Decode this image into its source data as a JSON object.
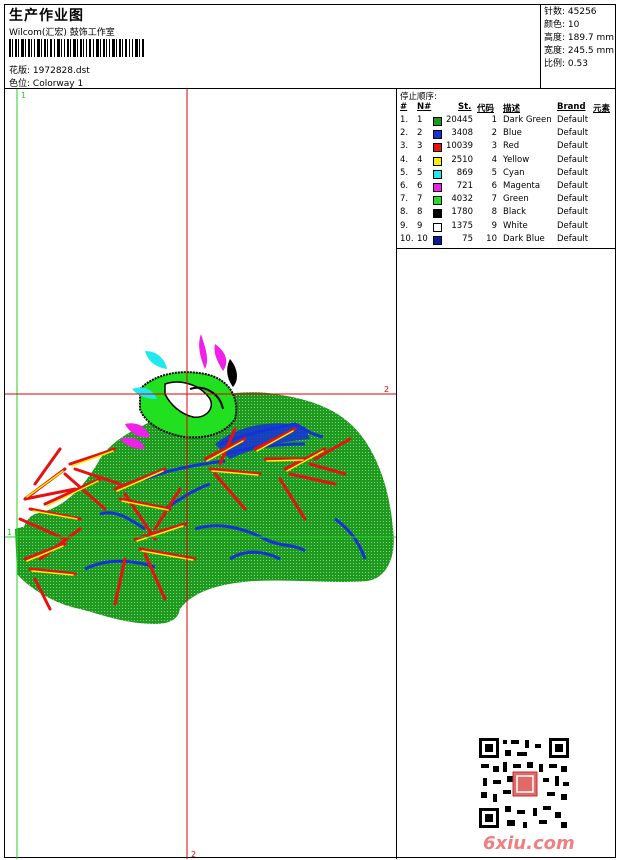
{
  "header": {
    "title": "生产作业图",
    "company": "Wilcom(汇宏) 鼓饰工作室",
    "design_label": "花版:",
    "design_value": "1972828.dst",
    "color_label": "色位:",
    "color_value": "Colorway 1"
  },
  "stats": {
    "stitches": "针数: 45256",
    "colors": "颜色: 10",
    "height": "高度: 189.7 mm",
    "width": "宽度: 245.5 mm",
    "scale": "比例: 0.53"
  },
  "canvas": {
    "marker_top": "1",
    "marker_left": "1",
    "marker_right": "2",
    "marker_bottom": "2"
  },
  "stop_sequence": {
    "title": "停止顺序:",
    "headers": {
      "num": "#",
      "n": "N#",
      "st": "St.",
      "code": "代码",
      "desc": "描述",
      "brand": "Brand",
      "element": "元素"
    },
    "rows": [
      {
        "num": "1.",
        "n": "1",
        "color": "#1e9a1e",
        "st": "20445",
        "code": "1",
        "desc": "Dark Green",
        "brand": "Default"
      },
      {
        "num": "2.",
        "n": "2",
        "color": "#1432d8",
        "st": "3408",
        "code": "2",
        "desc": "Blue",
        "brand": "Default"
      },
      {
        "num": "3.",
        "n": "3",
        "color": "#e81010",
        "st": "10039",
        "code": "3",
        "desc": "Red",
        "brand": "Default"
      },
      {
        "num": "4.",
        "n": "4",
        "color": "#f8f000",
        "st": "2510",
        "code": "4",
        "desc": "Yellow",
        "brand": "Default"
      },
      {
        "num": "5.",
        "n": "5",
        "color": "#20e8f0",
        "st": "869",
        "code": "5",
        "desc": "Cyan",
        "brand": "Default"
      },
      {
        "num": "6.",
        "n": "6",
        "color": "#f020e8",
        "st": "721",
        "code": "6",
        "desc": "Magenta",
        "brand": "Default"
      },
      {
        "num": "7.",
        "n": "7",
        "color": "#20e020",
        "st": "4032",
        "code": "7",
        "desc": "Green",
        "brand": "Default"
      },
      {
        "num": "8.",
        "n": "8",
        "color": "#000000",
        "st": "1780",
        "code": "8",
        "desc": "Black",
        "brand": "Default"
      },
      {
        "num": "9.",
        "n": "9",
        "color": "#ffffff",
        "st": "1375",
        "code": "9",
        "desc": "White",
        "brand": "Default"
      },
      {
        "num": "10.",
        "n": "10",
        "color": "#0a1a9a",
        "st": "75",
        "code": "10",
        "desc": "Dark Blue",
        "brand": "Default"
      }
    ]
  },
  "watermark": {
    "text": "6xiu.com"
  },
  "colors": {
    "guide_red": "#e00000",
    "guide_green": "#20d020"
  }
}
